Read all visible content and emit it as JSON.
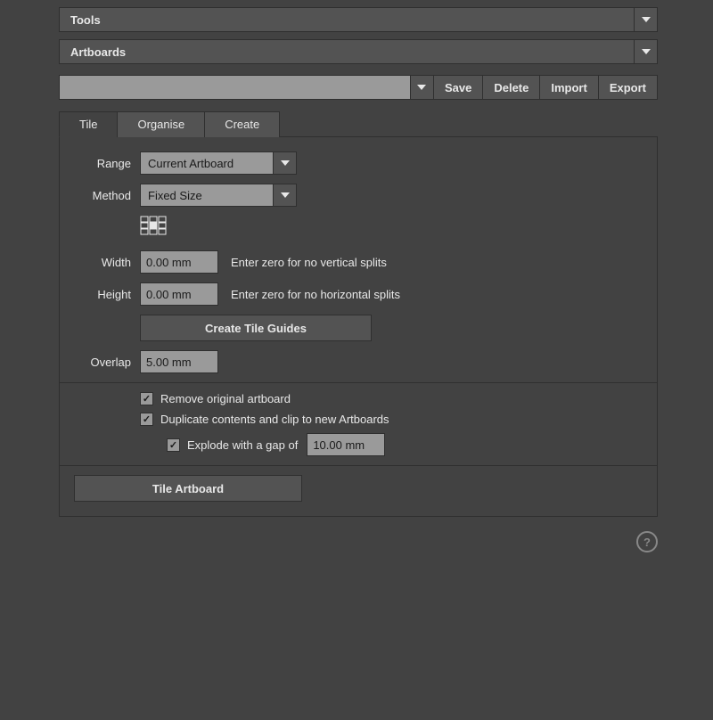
{
  "sections": {
    "tools": "Tools",
    "artboards": "Artboards"
  },
  "toolbar": {
    "save": "Save",
    "delete": "Delete",
    "import": "Import",
    "export": "Export"
  },
  "tabs": {
    "tile": "Tile",
    "organise": "Organise",
    "create": "Create"
  },
  "form": {
    "range_label": "Range",
    "range_value": "Current Artboard",
    "method_label": "Method",
    "method_value": "Fixed Size",
    "width_label": "Width",
    "width_value": "0.00 mm",
    "width_hint": "Enter zero for no vertical splits",
    "height_label": "Height",
    "height_value": "0.00 mm",
    "height_hint": "Enter zero for no horizontal splits",
    "create_guides": "Create Tile Guides",
    "overlap_label": "Overlap",
    "overlap_value": "5.00 mm",
    "chk_remove": "Remove original artboard",
    "chk_duplicate": "Duplicate contents and clip to new Artboards",
    "chk_explode": "Explode with a gap of",
    "explode_value": "10.00 mm",
    "tile_artboard": "Tile Artboard"
  },
  "help": "?"
}
